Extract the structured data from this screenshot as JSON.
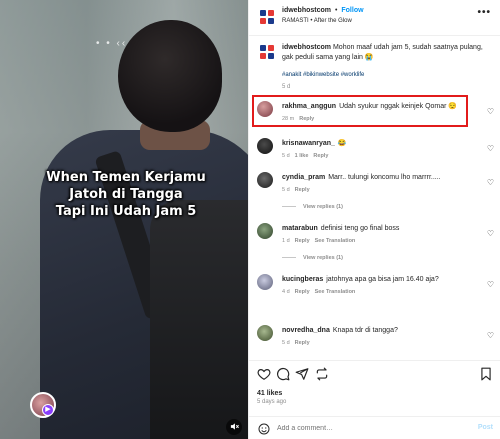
{
  "video": {
    "overlay_lines": [
      "When Temen Kerjamu",
      "Jatoh di Tangga",
      "Tapi Ini Udah Jam 5"
    ],
    "small_text": "• • ‹‹",
    "creator_badge_icon": "reels-icon",
    "mute_icon": "speaker-muted-icon"
  },
  "header": {
    "username": "idwebhostcom",
    "separator": "•",
    "follow_label": "Follow",
    "audio": "RAMASTI • After the Glow",
    "more_icon": "more-horizontal-icon",
    "more_glyph": "•••"
  },
  "caption": {
    "username": "idwebhostcom",
    "text": "Mohon maaf udah jam 5, sudah saatnya pulang, gak peduli sama yang lain 😭",
    "hashtags": "#anakit #bikinwebsite #worklife",
    "time": "5 d"
  },
  "comments": [
    {
      "username": "rakhma_anggun",
      "text": "Udah syukur nggak keinjek Qomar 😌",
      "time": "28 m",
      "likes": "",
      "actions": [
        "Reply"
      ],
      "replies": "",
      "avatar_color": "#9c5a5a"
    },
    {
      "username": "krisnawanryan_",
      "text": "😂",
      "time": "5 d",
      "likes": "1 like",
      "actions": [
        "Reply"
      ],
      "replies": "",
      "avatar_color": "#2b2b2b"
    },
    {
      "username": "cyndia_pram",
      "text": "Marr.. tulungi koncomu lho marrrr.....",
      "time": "5 d",
      "likes": "",
      "actions": [
        "Reply"
      ],
      "replies": "View replies (1)",
      "avatar_color": "#3a3a3a"
    },
    {
      "username": "matarabun",
      "text": "definisi teng go final boss",
      "time": "1 d",
      "likes": "",
      "actions": [
        "Reply",
        "See Translation"
      ],
      "replies": "View replies (1)",
      "avatar_color": "#4f6b4a"
    },
    {
      "username": "kucingberas",
      "text": "jatohnya apa ga bisa jam 16.40 aja?",
      "time": "4 d",
      "likes": "",
      "actions": [
        "Reply",
        "See Translation"
      ],
      "replies": "",
      "avatar_color": "#8c8fa8"
    },
    {
      "username": "novredha_dna",
      "text": "Knapa tdr di tangga?",
      "time": "5 d",
      "likes": "",
      "actions": [
        "Reply"
      ],
      "replies": "",
      "avatar_color": "#6e7f5a"
    }
  ],
  "footer": {
    "likes": "41 likes",
    "date": "5 days ago",
    "comment_placeholder": "Add a comment…",
    "post_label": "Post"
  },
  "colors": {
    "accent": "#0095f6",
    "highlight": "#e21b1b",
    "muted_text": "#8e8e8e"
  }
}
